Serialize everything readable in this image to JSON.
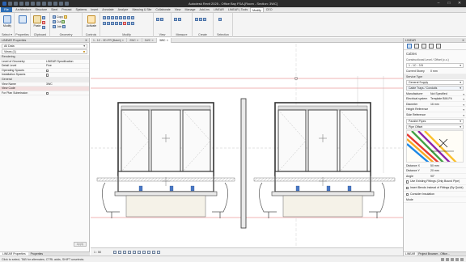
{
  "window": {
    "title": "Autodesk Revit 2025 - Office Bay FSA-[Room - Section: 3WC]",
    "minimize": "–",
    "maximize": "□",
    "close": "✕"
  },
  "tabs": [
    "File",
    "Architecture",
    "Structure",
    "Steel",
    "Precast",
    "Systems",
    "Insert",
    "Annotate",
    "Analyze",
    "Massing & Site",
    "Collaborate",
    "View",
    "Manage",
    "Add-Ins",
    "LINEAR",
    "LINEAR | Tools",
    "Modify",
    "CEO"
  ],
  "active_tab": "Modify",
  "ribbon": {
    "modify_label": "Modify",
    "select_label": "Select ▾",
    "properties_label": "Properties",
    "clipboard_label": "Clipboard",
    "geometry_label": "Geometry",
    "controls_label": "Controls",
    "modify_group_label": "Modify",
    "view_label": "View",
    "measure_label": "Measure",
    "create_label": "Create",
    "selection_label": "Selection",
    "copy_label": "Copy",
    "cut_label": "Cut",
    "join_label": "Join",
    "paste_label": "Paste",
    "activate_label": "Activate"
  },
  "left_panel": {
    "header": "LINEAR Properties",
    "type_selector": "All Data",
    "views_filter": "Views (1)",
    "edit_type": "",
    "sections": [
      {
        "title": "Rendering",
        "rows": [
          {
            "k": "Level of Geometry",
            "v": "LINEAR Specification"
          },
          {
            "k": "Detail Level",
            "v": "Fine"
          },
          {
            "k": "Operating Spaces",
            "v": "",
            "check": true
          },
          {
            "k": "Installation Spaces",
            "v": "",
            "check": true
          }
        ]
      },
      {
        "title": "General",
        "rows": [
          {
            "k": "View Name",
            "v": "3WC"
          },
          {
            "k": "View Code",
            "v": "",
            "highlight": true
          },
          {
            "k": "For Plan Submission",
            "v": "",
            "check": true
          }
        ]
      }
    ],
    "apply": "Apply",
    "bottom_tabs": [
      "LINEAR Properties",
      "Properties"
    ]
  },
  "view_tabs": [
    {
      "label": "1 - 1C - 3D IFR [Batch]",
      "active": false
    },
    {
      "label": "2WC",
      "active": false
    },
    {
      "label": "1WC",
      "active": false
    },
    {
      "label": "3WC",
      "active": true
    }
  ],
  "view_control": {
    "scale": "1 : 50"
  },
  "right_panel": {
    "header": "LINEAR",
    "title": "Cables",
    "constructive": "Constructional Level / Offset (c.o.)",
    "offset_value": "1 - 1C - 3 B",
    "current_storey_label": "Current Storey",
    "current_storey_value": "0 mm",
    "service_type_label": "Service Type",
    "service_type": "General Supply",
    "selection_label": "Cable Trays / Conduits",
    "rows": [
      {
        "k": "Manufacturer",
        "v": "Not Specified"
      },
      {
        "k": "Electrical system",
        "v": "Template BIM-Fit"
      },
      {
        "k": "Diameter",
        "v": "16 mm"
      },
      {
        "k": "Height Reference",
        "v": ""
      },
      {
        "k": "Side Reference",
        "v": ""
      }
    ],
    "parallel_pipes": "Parallel Pipes",
    "pipe_offset": "Pipe Offset",
    "bottom_rows": [
      {
        "k": "Distance X",
        "v": "50 mm"
      },
      {
        "k": "Distance Y",
        "v": "20 mm"
      },
      {
        "k": "Angle",
        "v": "90°"
      }
    ],
    "checks": [
      "Use Existing Fittings (Only Bound Pipe)",
      "Insert Bends Instead of Fittings (By Quick)",
      "Consider Insulation"
    ],
    "mode_label": "Mode",
    "bottom_tabs": [
      "LINEAR",
      "Project Browser - Office..."
    ]
  },
  "status": {
    "message": "Click to select, TAB for alternates, CTRL adds, SHIFT unselects."
  }
}
